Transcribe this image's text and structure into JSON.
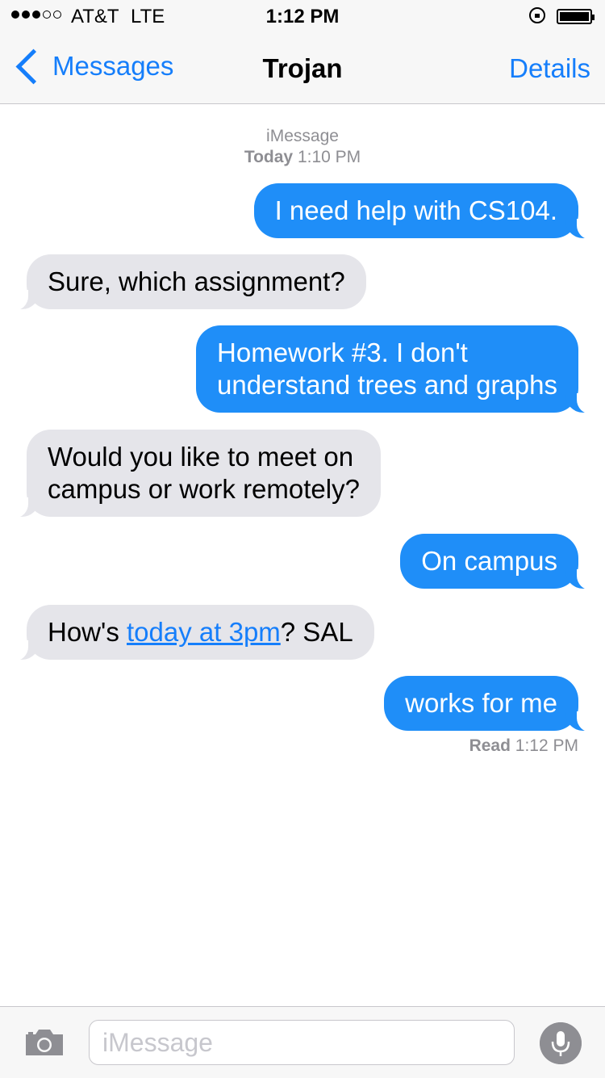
{
  "status_bar": {
    "carrier": "AT&T",
    "network": "LTE",
    "time": "1:12 PM",
    "signal_strength": 3,
    "signal_max": 5
  },
  "nav": {
    "back_label": "Messages",
    "title": "Trojan",
    "details_label": "Details"
  },
  "conversation": {
    "service": "iMessage",
    "day": "Today",
    "time": "1:10 PM",
    "messages": [
      {
        "from": "me",
        "text": "I need help with CS104."
      },
      {
        "from": "them",
        "text": "Sure, which assignment?"
      },
      {
        "from": "me",
        "line1": "Homework #3. I don't",
        "line2": "understand trees and graphs"
      },
      {
        "from": "them",
        "line1": "Would you like to meet on",
        "line2": "campus or work remotely?"
      },
      {
        "from": "me",
        "text": "On campus"
      },
      {
        "from": "them",
        "before": "How's ",
        "link": "today at 3pm",
        "after": "? SAL"
      },
      {
        "from": "me",
        "text": "works for me"
      }
    ],
    "read_label": "Read",
    "read_time": "1:12 PM"
  },
  "input_bar": {
    "placeholder": "iMessage"
  },
  "colors": {
    "accent": "#157efb",
    "outgoing_bubble": "#1f8ef8",
    "incoming_bubble": "#e5e5ea",
    "meta_text": "#8e8e93"
  }
}
